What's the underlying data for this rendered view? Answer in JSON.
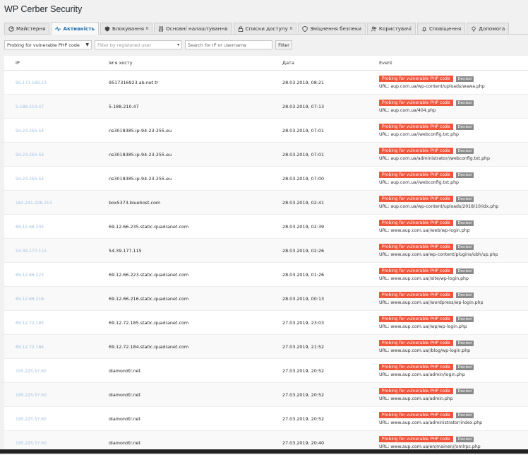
{
  "title": "WP Cerber Security",
  "tabs": [
    {
      "label": "Майстерня",
      "icon": "dashboard-icon",
      "sup": ""
    },
    {
      "label": "Активність",
      "icon": "activity-icon",
      "sup": ""
    },
    {
      "label": "Блокування",
      "icon": "shield-icon",
      "sup": "0"
    },
    {
      "label": "Основні налаштування",
      "icon": "sliders-icon",
      "sup": ""
    },
    {
      "label": "Списки доступу",
      "icon": "lock-icon",
      "sup": "0"
    },
    {
      "label": "Зміцнення безпеки",
      "icon": "hardening-icon",
      "sup": ""
    },
    {
      "label": "Користувачі",
      "icon": "users-icon",
      "sup": ""
    },
    {
      "label": "Сповіщення",
      "icon": "bell-icon",
      "sup": ""
    },
    {
      "label": "Допомога",
      "icon": "lightbulb-icon",
      "sup": ""
    }
  ],
  "filters": {
    "event_select": "Probing for vulnerable PHP code",
    "user_select": "Filter by registered user",
    "search_placeholder": "Search for IP or username",
    "filter_button": "Filter"
  },
  "table": {
    "headers": {
      "ip": "IP",
      "host": "Ім'я хосту",
      "date": "Дата",
      "event": "Event"
    },
    "event_label": "Probing for vulnerable PHP code",
    "status_label": "Denied",
    "rows": [
      {
        "ip": "95.173.169.23",
        "host": "9517316923.ab.net.tr",
        "date": "28.03.2019, 08:21",
        "url": "URL: aup.com.ua/wp-content/uploads/wawa.php"
      },
      {
        "ip": "5.188.210.47",
        "host": "5.188.210.47",
        "date": "28.03.2019, 07:13",
        "url": "URL: aup.com.ua/404.php"
      },
      {
        "ip": "94.23.255.54",
        "host": "ns3018385.ip-94-23-255.eu",
        "date": "28.03.2019, 07:01",
        "url": "URL: aup.com.ua//webconfig.txt.php"
      },
      {
        "ip": "94.23.255.54",
        "host": "ns3018385.ip-94-23-255.eu",
        "date": "28.03.2019, 07:01",
        "url": "URL: aup.com.ua/administrator//webconfig.txt.php"
      },
      {
        "ip": "94.23.255.54",
        "host": "ns3018385.ip-94-23-255.eu",
        "date": "28.03.2019, 07:00",
        "url": "URL: aup.com.ua//webconfig.txt.php"
      },
      {
        "ip": "162.241.226.214",
        "host": "box5373.bluehost.com",
        "date": "28.03.2019, 02:41",
        "url": "URL: aup.com.ua/wp-content/uploads/2018/10/idx.php"
      },
      {
        "ip": "69.12.66.235",
        "host": "69.12.66.235.static.quadranet.com",
        "date": "28.03.2019, 02:39",
        "url": "URL: www.aup.com.ua//web/wp-login.php"
      },
      {
        "ip": "54.39.177.115",
        "host": "54.39.177.115",
        "date": "28.03.2019, 02:26",
        "url": "URL: www.aup.com.ua/wp-content/plugins/ubh/up.php"
      },
      {
        "ip": "69.12.66.223",
        "host": "69.12.66.223.static.quadranet.com",
        "date": "28.03.2019, 01:26",
        "url": "URL: www.aup.com.ua//site/wp-login.php"
      },
      {
        "ip": "69.12.66.216",
        "host": "69.12.66.216.static.quadranet.com",
        "date": "28.03.2019, 00:13",
        "url": "URL: www.aup.com.ua//wordpress/wp-login.php"
      },
      {
        "ip": "69.12.72.185",
        "host": "69.12.72.185.static.quadranet.com",
        "date": "27.03.2019, 23:03",
        "url": "URL: www.aup.com.ua//wp/wp-login.php"
      },
      {
        "ip": "69.12.72.184",
        "host": "69.12.72.184.static.quadranet.com",
        "date": "27.03.2019, 21:52",
        "url": "URL: www.aup.com.ua//blog/wp-login.php"
      },
      {
        "ip": "195.225.57.60",
        "host": "diamondtr.net",
        "date": "27.03.2019, 20:52",
        "url": "URL: www.aup.com.ua/admin/login.php"
      },
      {
        "ip": "195.225.57.60",
        "host": "diamondtr.net",
        "date": "27.03.2019, 20:52",
        "url": "URL: www.aup.com.ua/admin.php"
      },
      {
        "ip": "195.225.57.60",
        "host": "diamondtr.net",
        "date": "27.03.2019, 20:52",
        "url": "URL: www.aup.com.ua/administrator/index.php"
      },
      {
        "ip": "195.225.57.60",
        "host": "diamondtr.net",
        "date": "27.03.2019, 20:40",
        "url": "URL: www.aup.com.ua/en/mainen//xmlrpc.php"
      }
    ]
  }
}
